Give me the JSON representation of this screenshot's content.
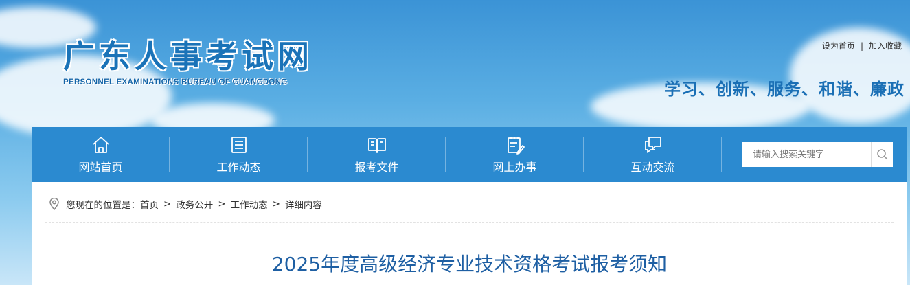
{
  "header": {
    "logo_title": "广东人事考试网",
    "logo_subtitle": "PERSONNEL EXAMINATIONS BUREAU OF GUANGDONG",
    "top_links": {
      "set_home": "设为首页",
      "separator": "|",
      "add_favorite": "加入收藏"
    },
    "slogan": "学习、创新、服务、和谐、廉政"
  },
  "nav": {
    "items": [
      {
        "label": "网站首页",
        "icon": "home-icon"
      },
      {
        "label": "工作动态",
        "icon": "document-list-icon"
      },
      {
        "label": "报考文件",
        "icon": "open-book-icon"
      },
      {
        "label": "网上办事",
        "icon": "clipboard-edit-icon"
      },
      {
        "label": "互动交流",
        "icon": "chat-bubbles-icon"
      }
    ],
    "search": {
      "placeholder": "请输入搜索关键字",
      "icon": "search-icon"
    }
  },
  "breadcrumb": {
    "icon": "location-pin-icon",
    "prefix": "您现在的位置是：",
    "items": [
      "首页",
      "政务公开",
      "工作动态",
      "详细内容"
    ],
    "separator": ">"
  },
  "article": {
    "title": "2025年度高级经济专业技术资格考试报考须知"
  },
  "colors": {
    "nav_bg": "#2b8ad0",
    "title_color": "#1e5fa3",
    "logo_color": "#1a73b8"
  }
}
